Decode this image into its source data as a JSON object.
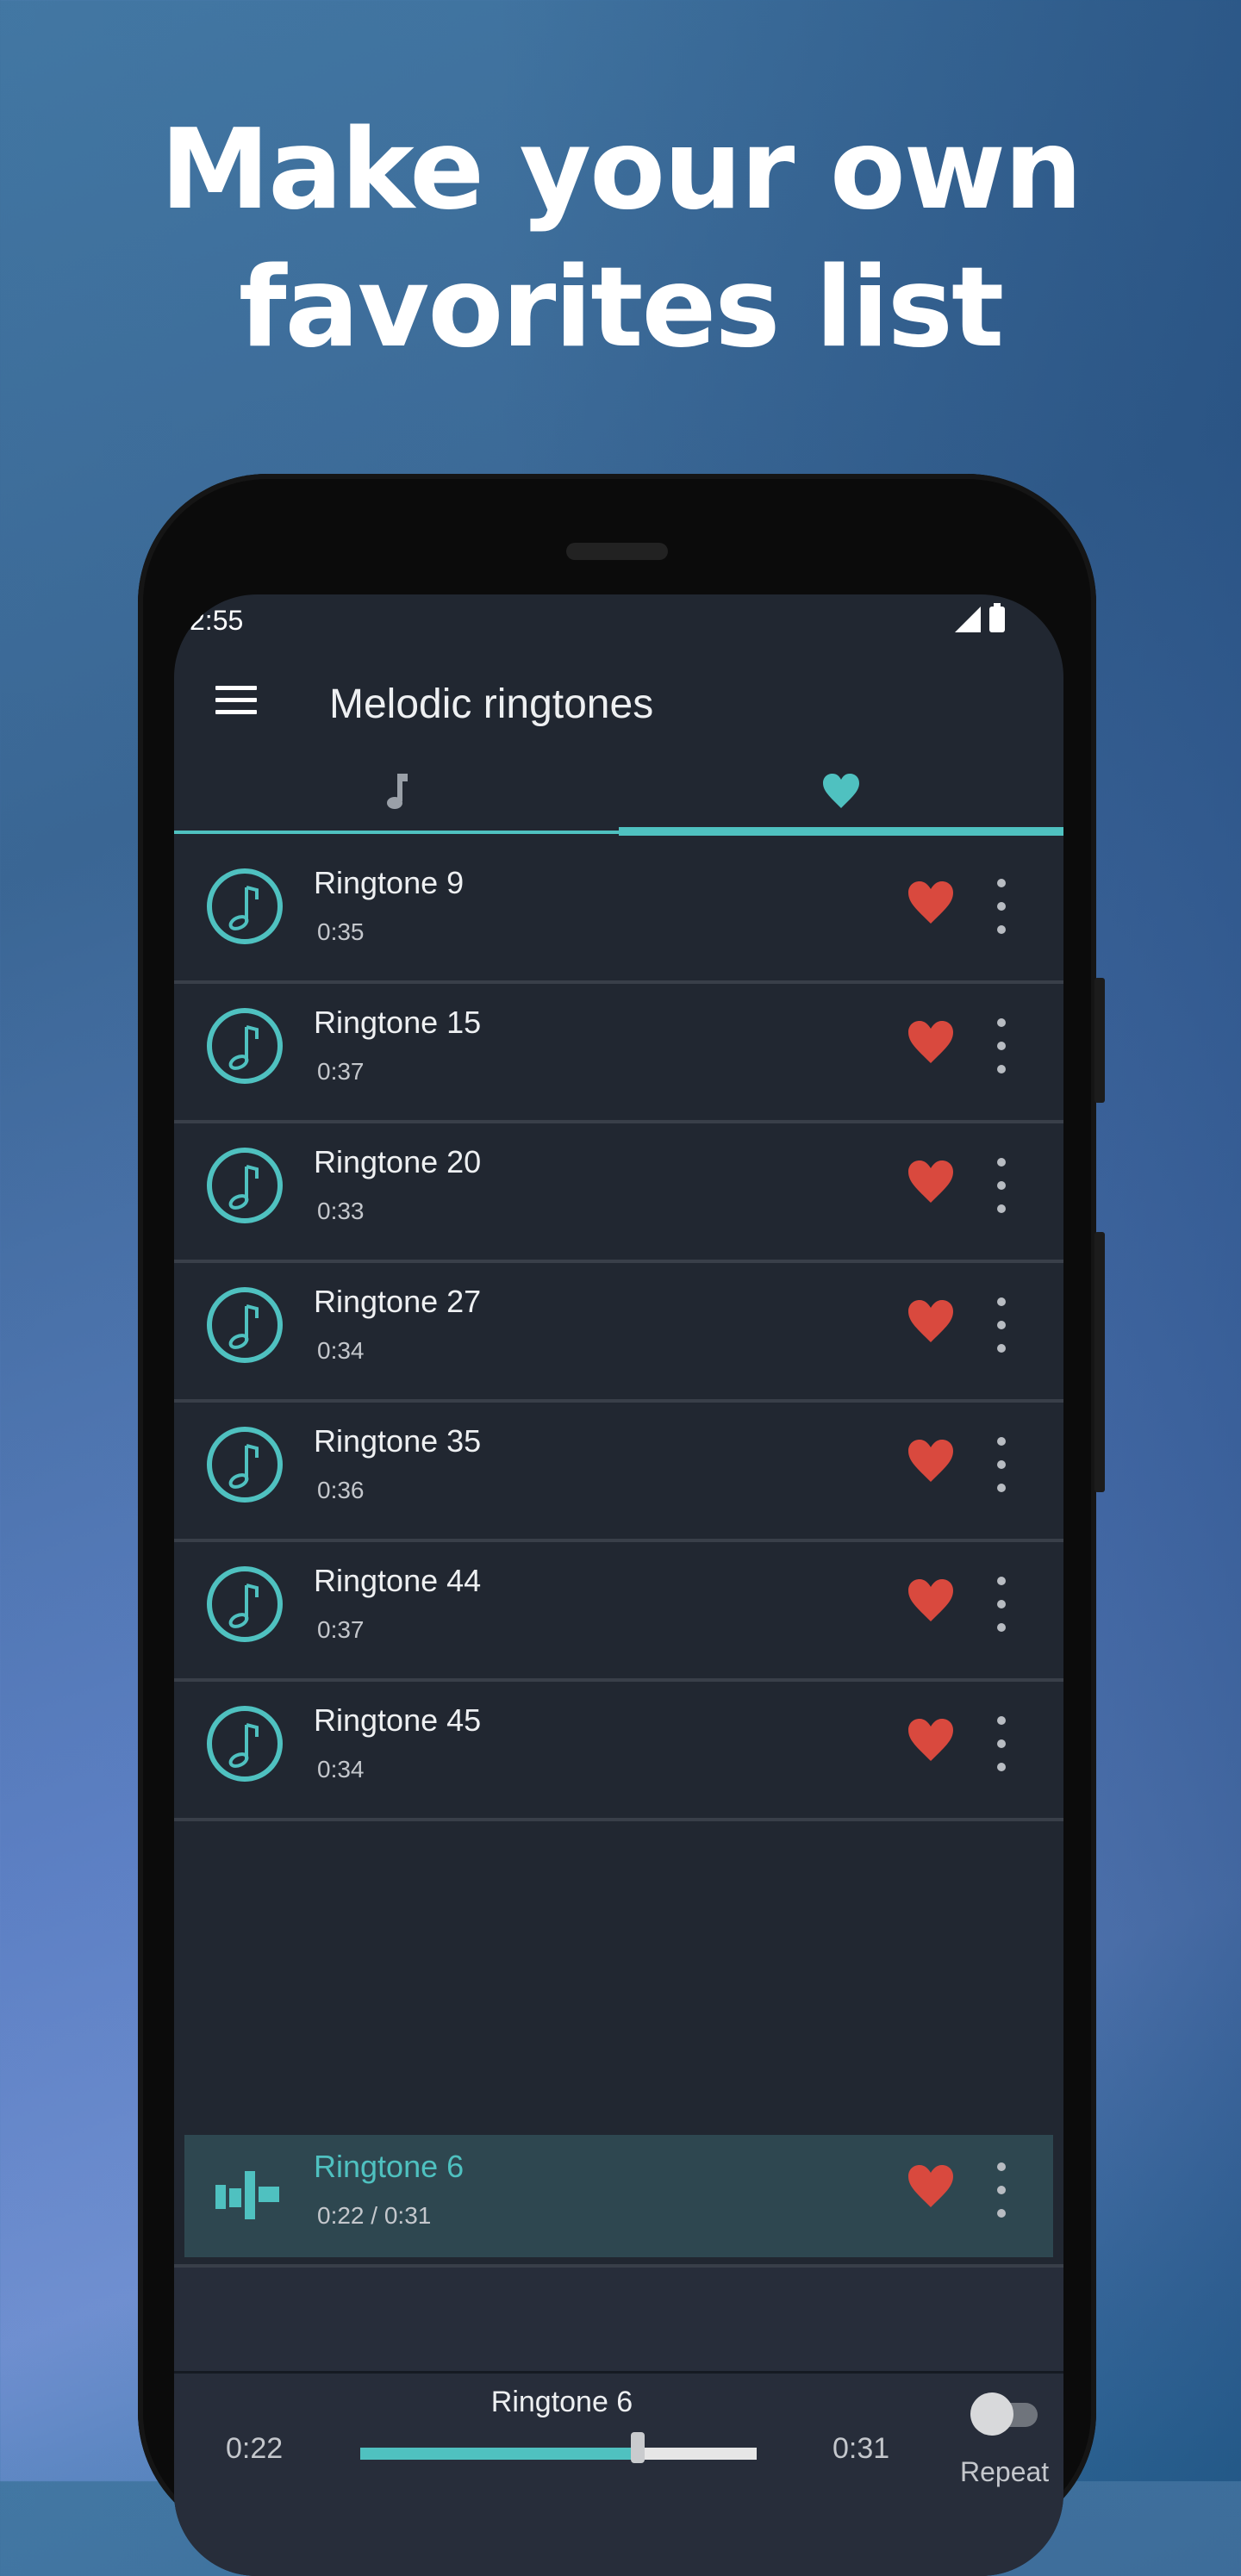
{
  "headline": {
    "line1": "Make your own",
    "line2": "favorites list"
  },
  "status_bar": {
    "time": "2:55",
    "icons": [
      "signal-alert-icon",
      "battery-icon"
    ]
  },
  "toolbar": {
    "menu_icon": "hamburger-menu-icon",
    "title": "Melodic ringtones"
  },
  "tabs": [
    {
      "icon": "music-note-icon",
      "selected": false,
      "color": "#9aa0a8"
    },
    {
      "icon": "heart-icon",
      "selected": true,
      "color": "#4fc1c0"
    }
  ],
  "ringtones": [
    {
      "name": "Ringtone 9",
      "duration": "0:35",
      "favorite": true
    },
    {
      "name": "Ringtone 15",
      "duration": "0:37",
      "favorite": true
    },
    {
      "name": "Ringtone 20",
      "duration": "0:33",
      "favorite": true
    },
    {
      "name": "Ringtone 27",
      "duration": "0:34",
      "favorite": true
    },
    {
      "name": "Ringtone 35",
      "duration": "0:36",
      "favorite": true
    },
    {
      "name": "Ringtone 44",
      "duration": "0:37",
      "favorite": true
    },
    {
      "name": "Ringtone 45",
      "duration": "0:34",
      "favorite": true
    }
  ],
  "now_playing_row": {
    "name": "Ringtone 6",
    "elapsed": "0:22",
    "separator": "/",
    "total": "0:31",
    "favorite": true
  },
  "player": {
    "title": "Ringtone 6",
    "current_time": "0:22",
    "total_time": "0:31",
    "progress_fraction": 0.7,
    "repeat_label": "Repeat",
    "repeat_on": false
  },
  "colors": {
    "accent": "#4fc1c0",
    "heart": "#d9493e",
    "background": "#212731",
    "playing_row": "#2e4750"
  }
}
